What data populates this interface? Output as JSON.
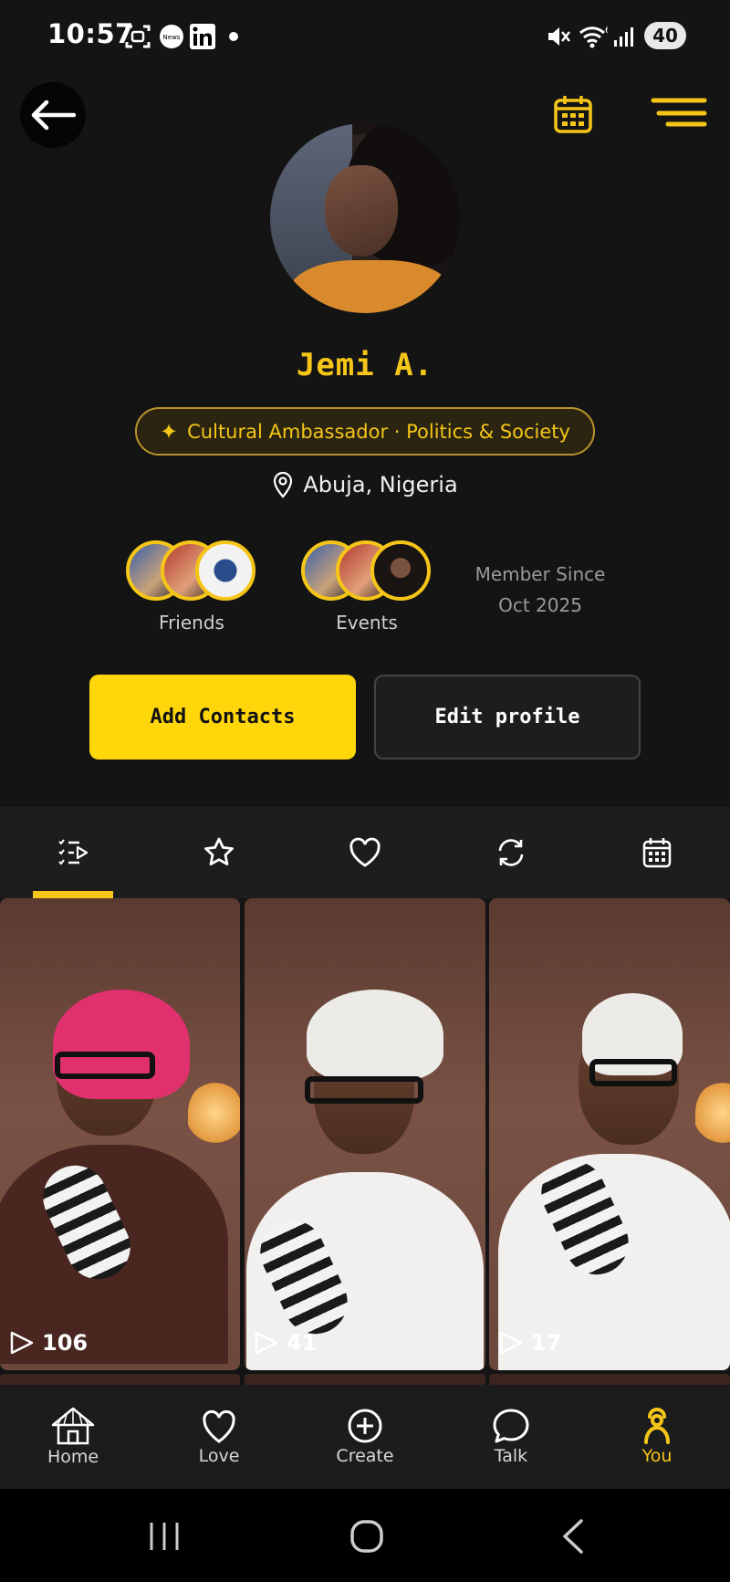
{
  "status": {
    "time": "10:57",
    "battery": "40",
    "notif_icons": [
      "screenshot-icon",
      "news-icon",
      "linkedin-icon",
      "dot-icon"
    ],
    "system_icons": [
      "mute-icon",
      "wifi-icon",
      "signal-icon"
    ]
  },
  "header": {
    "back_icon": "arrow-left-icon",
    "calendar_icon": "calendar-icon",
    "menu_icon": "menu-icon"
  },
  "profile": {
    "name": "Jemi A.",
    "role": "Cultural Ambassador · Politics & Society",
    "location": "Abuja, Nigeria",
    "friends_label": "Friends",
    "events_label": "Events",
    "member_since_label": "Member Since",
    "member_since_date": "Oct 2025"
  },
  "actions": {
    "add_contacts": "Add Contacts",
    "edit_profile": "Edit profile"
  },
  "tabs": [
    {
      "icon": "list-play-icon",
      "active": true
    },
    {
      "icon": "star-icon",
      "active": false
    },
    {
      "icon": "heart-icon",
      "active": false
    },
    {
      "icon": "repost-icon",
      "active": false
    },
    {
      "icon": "calendar-icon",
      "active": false
    }
  ],
  "videos": [
    {
      "plays": "106"
    },
    {
      "plays": "41"
    },
    {
      "plays": "17"
    }
  ],
  "bottom_nav": [
    {
      "label": "Home",
      "icon": "hut-icon",
      "active": false
    },
    {
      "label": "Love",
      "icon": "heart-icon",
      "active": false
    },
    {
      "label": "Create",
      "icon": "plus-circle-icon",
      "active": false
    },
    {
      "label": "Talk",
      "icon": "chat-bubble-icon",
      "active": false
    },
    {
      "label": "You",
      "icon": "person-icon",
      "active": true
    }
  ],
  "colors": {
    "accent": "#f5c518",
    "background": "#141414",
    "button_primary": "#ffd60a"
  }
}
